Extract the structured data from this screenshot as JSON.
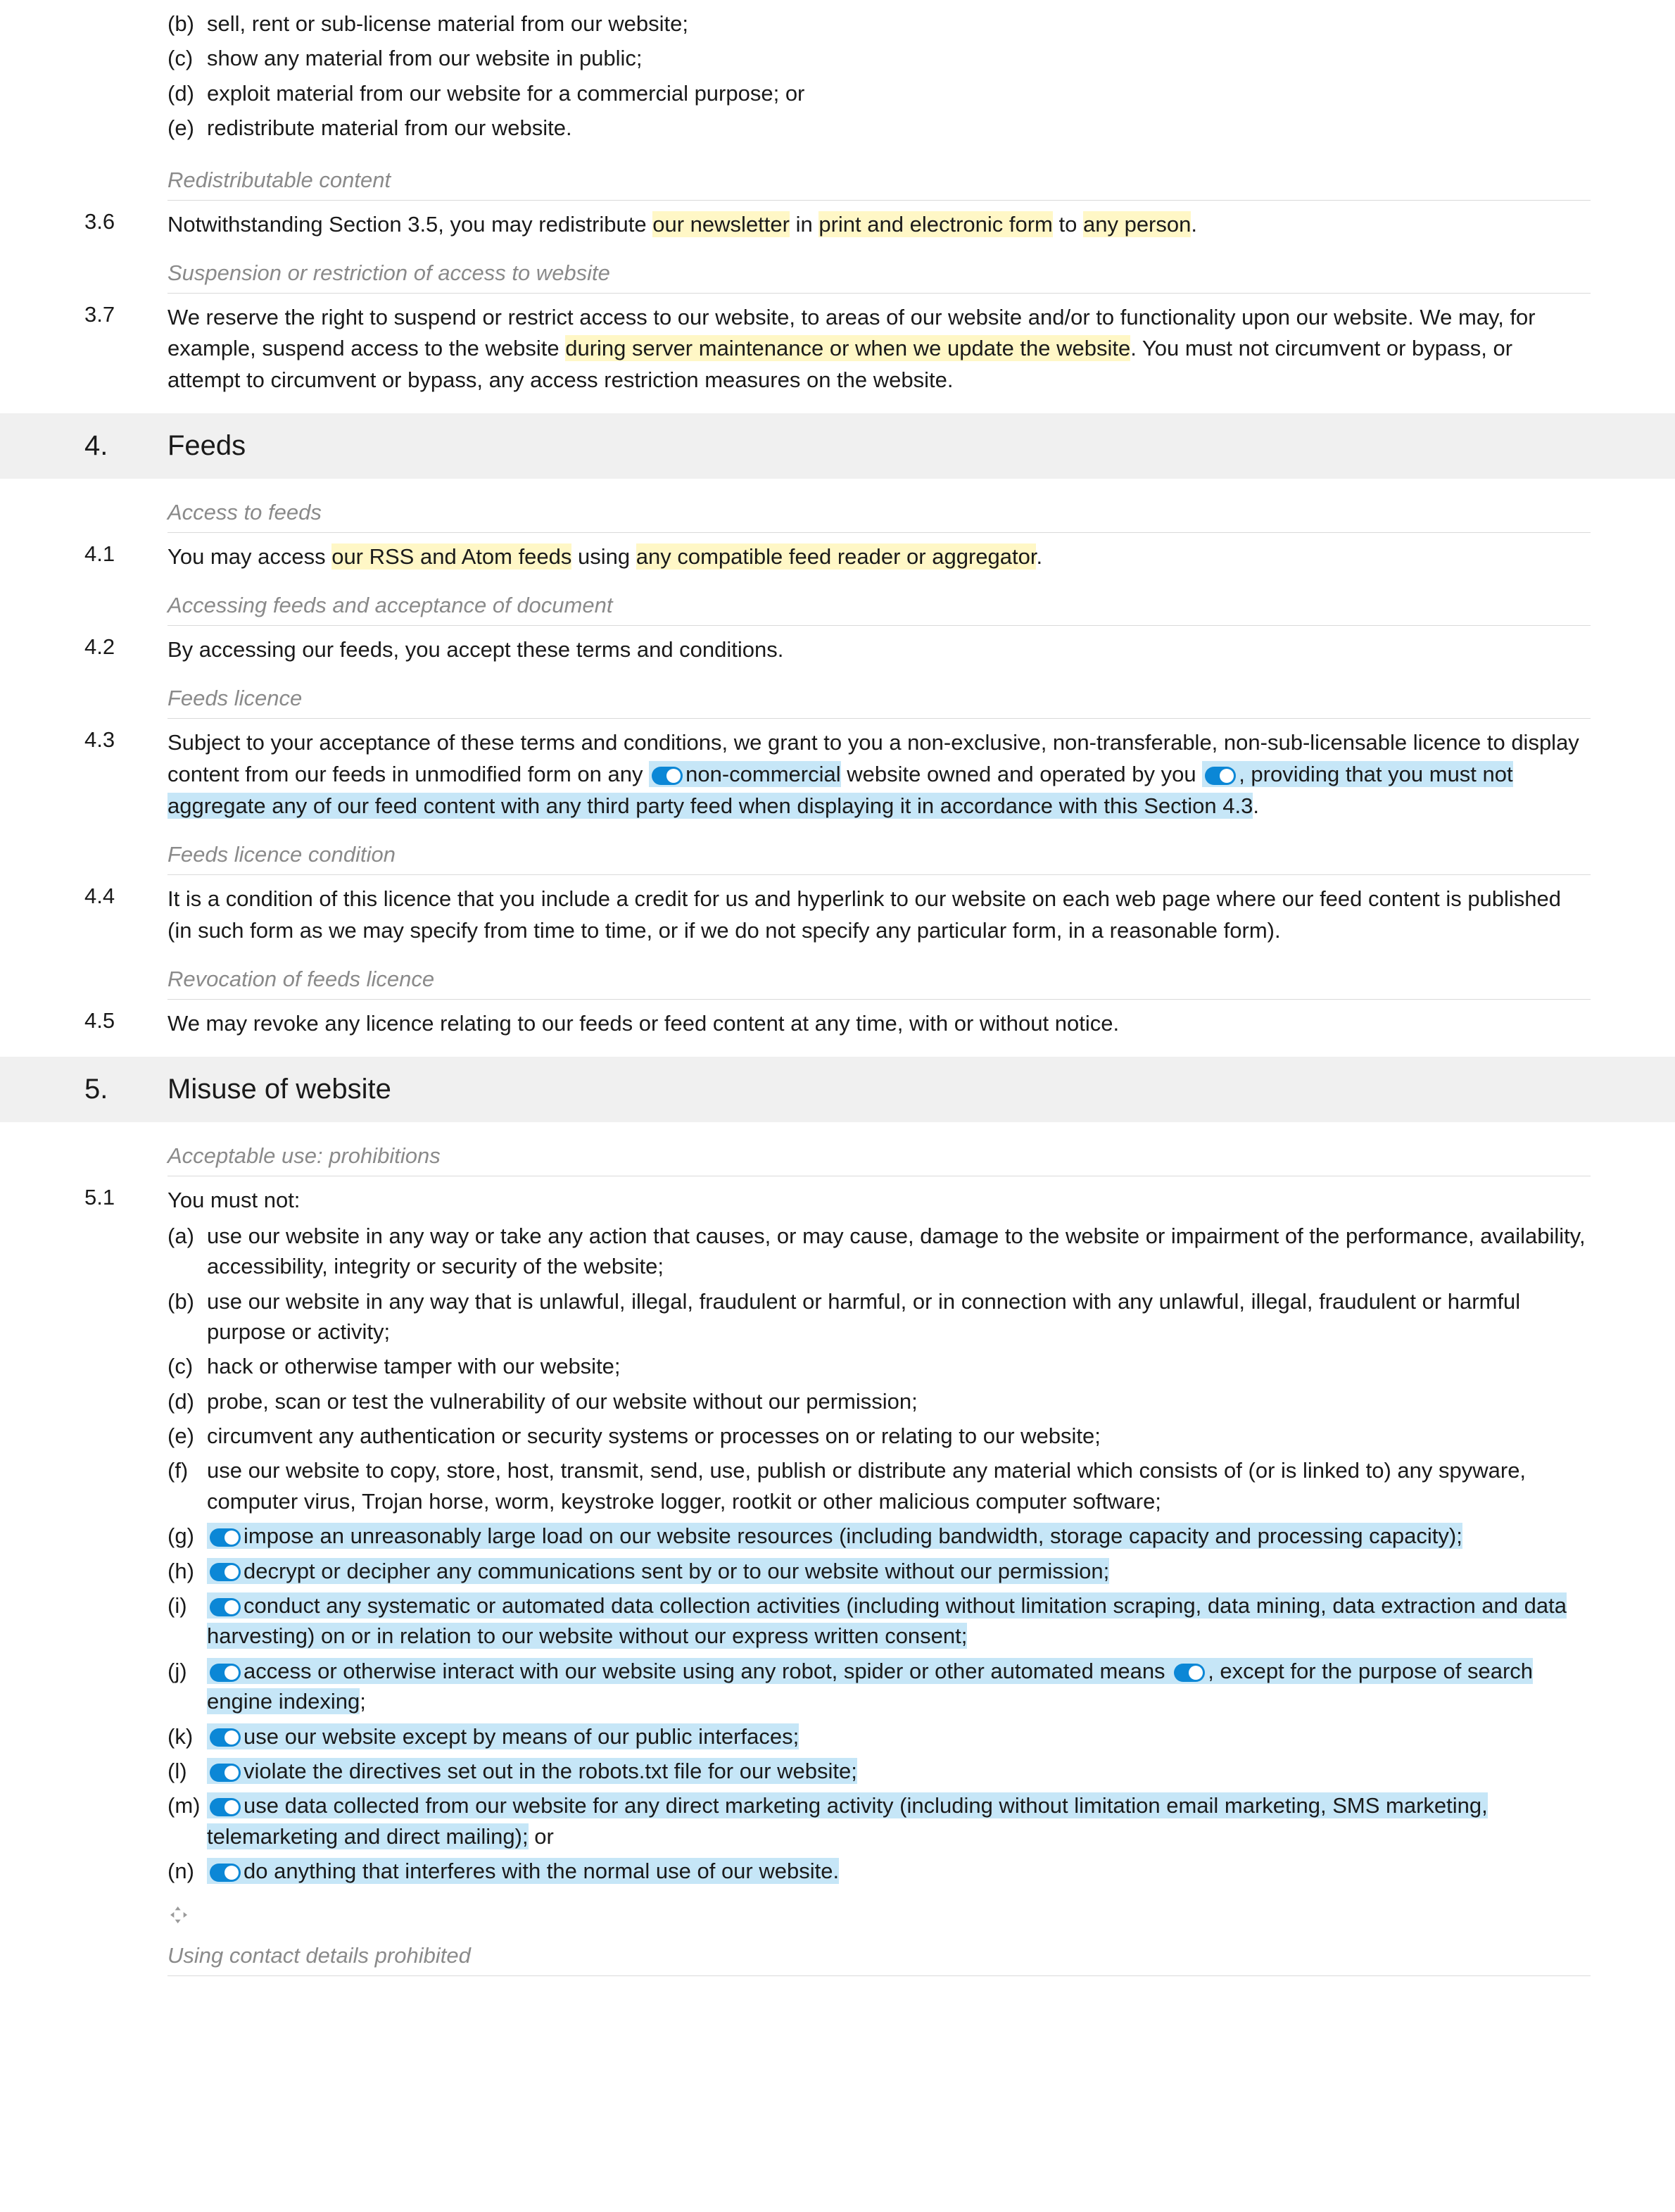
{
  "top_list": [
    {
      "m": "(b)",
      "t": "sell, rent or sub-license material from our website;"
    },
    {
      "m": "(c)",
      "t": "show any material from our website in public;"
    },
    {
      "m": "(d)",
      "t": "exploit material from our website for a commercial purpose; or"
    },
    {
      "m": "(e)",
      "t": "redistribute material from our website."
    }
  ],
  "sh_redist": "Redistributable content",
  "c36_num": "3.6",
  "c36_a": "Notwithstanding Section 3.5, you may redistribute ",
  "c36_b": "our newsletter",
  "c36_c": " in ",
  "c36_d": "print and electronic form",
  "c36_e": " to ",
  "c36_f": "any person",
  "c36_g": ".",
  "sh_susp": "Suspension or restriction of access to website",
  "c37_num": "3.7",
  "c37_a": "We reserve the right to suspend or restrict access to our website, to areas of our website and/or to functionality upon our website. We may, for example, suspend access to the website ",
  "c37_b": "during server maintenance or when we update the website",
  "c37_c": ". You must not circumvent or bypass, or attempt to circumvent or bypass, any access restriction measures on the website.",
  "sec4_num": "4.",
  "sec4_title": "Feeds",
  "sh_access_feeds": "Access to feeds",
  "c41_num": "4.1",
  "c41_a": "You may access ",
  "c41_b": "our RSS and Atom feeds",
  "c41_c": " using ",
  "c41_d": "any compatible feed reader or aggregator",
  "c41_e": ".",
  "sh_accept": "Accessing feeds and acceptance of document",
  "c42_num": "4.2",
  "c42_t": "By accessing our feeds, you accept these terms and conditions.",
  "sh_feedslic": "Feeds licence",
  "c43_num": "4.3",
  "c43_a": "Subject to your acceptance of these terms and conditions, we grant to you a non-exclusive, non-transferable, non-sub-licensable licence to display content from our feeds in unmodified form on any ",
  "c43_b": "non-commercial",
  "c43_c": " website owned and operated by you ",
  "c43_d": ", providing that you must not aggregate any of our feed content with any third party feed when displaying it in accordance with this Section 4.3",
  "c43_e": ".",
  "sh_feedcond": "Feeds licence condition",
  "c44_num": "4.4",
  "c44_t": "It is a condition of this licence that you include a credit for us and hyperlink to our website on each web page where our feed content is published (in such form as we may specify from time to time, or if we do not specify any particular form, in a reasonable form).",
  "sh_revoc": "Revocation of feeds licence",
  "c45_num": "4.5",
  "c45_t": "We may revoke any licence relating to our feeds or feed content at any time, with or without notice.",
  "sec5_num": "5.",
  "sec5_title": "Misuse of website",
  "sh_accuse": "Acceptable use: prohibitions",
  "c51_num": "5.1",
  "c51_intro": "You must not:",
  "c51_a_m": "(a)",
  "c51_a_t": "use our website in any way or take any action that causes, or may cause, damage to the website or impairment of the performance, availability, accessibility, integrity or security of the website;",
  "c51_b_m": "(b)",
  "c51_b_t": "use our website in any way that is unlawful, illegal, fraudulent or harmful, or in connection with any unlawful, illegal, fraudulent or harmful purpose or activity;",
  "c51_c_m": "(c)",
  "c51_c_t": "hack or otherwise tamper with our website;",
  "c51_d_m": "(d)",
  "c51_d_t": "probe, scan or test the vulnerability of our website without our permission;",
  "c51_e_m": "(e)",
  "c51_e_t": "circumvent any authentication or security systems or processes on or relating to our website;",
  "c51_f_m": "(f)",
  "c51_f_t": "use our website to copy, store, host, transmit, send, use, publish or distribute any material which consists of (or is linked to) any spyware, computer virus, Trojan horse, worm, keystroke logger, rootkit or other malicious computer software;",
  "c51_g_m": "(g)",
  "c51_g_t": "impose an unreasonably large load on our website resources (including bandwidth, storage capacity and processing capacity);",
  "c51_h_m": "(h)",
  "c51_h_t": "decrypt or decipher any communications sent by or to our website without our permission;",
  "c51_i_m": "(i)",
  "c51_i_t": "conduct any systematic or automated data collection activities (including without limitation scraping, data mining, data extraction and data harvesting) on or in relation to our website without our express written consent;",
  "c51_j_m": "(j)",
  "c51_j_t1": "access or otherwise interact with our website using any robot, spider or other automated means",
  "c51_j_t2": ", except for the purpose of search engine indexing",
  "c51_j_sc": ";",
  "c51_k_m": "(k)",
  "c51_k_t": "use our website except by means of our public interfaces;",
  "c51_l_m": "(l)",
  "c51_l_t": "violate the directives set out in the robots.txt file for our website;",
  "c51_m_m": "(m)",
  "c51_m_t": "use data collected from our website for any direct marketing activity (including without limitation email marketing, SMS marketing, telemarketing and direct mailing);",
  "c51_m_or": " or",
  "c51_n_m": "(n)",
  "c51_n_t": "do anything that interferes with the normal use of our website.",
  "sh_contact": "Using contact details prohibited"
}
